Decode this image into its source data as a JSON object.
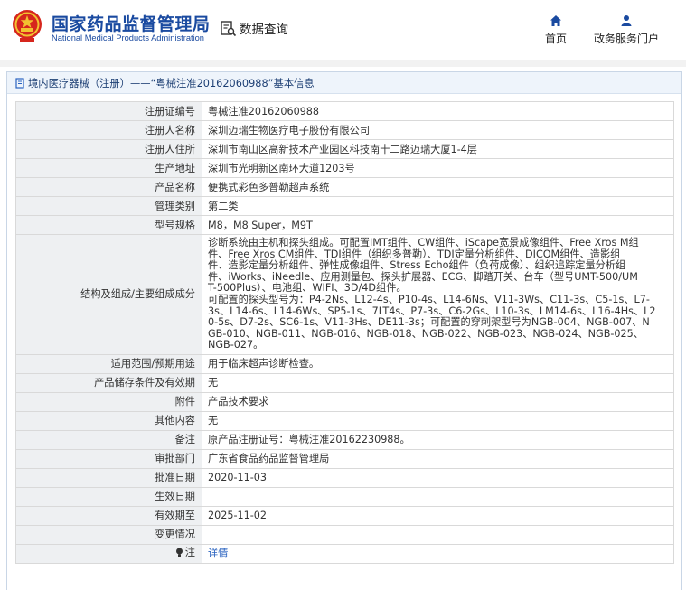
{
  "header": {
    "site_name_cn": "国家药品监督管理局",
    "site_name_en": "National Medical Products Administration",
    "data_query_label": "数据查询",
    "nav": [
      {
        "label": "首页",
        "icon": "home-icon"
      },
      {
        "label": "政务服务门户",
        "icon": "user-icon"
      }
    ]
  },
  "breadcrumb": {
    "text": "境内医疗器械（注册）——“粤械注准20162060988”基本信息"
  },
  "record": {
    "rows": [
      {
        "label": "注册证编号",
        "value": "粤械注准20162060988"
      },
      {
        "label": "注册人名称",
        "value": "深圳迈瑞生物医疗电子股份有限公司"
      },
      {
        "label": "注册人住所",
        "value": "深圳市南山区高新技术产业园区科技南十二路迈瑞大厦1-4层"
      },
      {
        "label": "生产地址",
        "value": "深圳市光明新区南环大道1203号"
      },
      {
        "label": "产品名称",
        "value": "便携式彩色多普勒超声系统"
      },
      {
        "label": "管理类别",
        "value": "第二类"
      },
      {
        "label": "型号规格",
        "value": "M8，M8 Super，M9T"
      },
      {
        "label": "结构及组成/主要组成成分",
        "value_lines": [
          "诊断系统由主机和探头组成。可配置IMT组件、CW组件、iScape宽景成像组件、Free Xros M组",
          "件、Free Xros CM组件、TDI组件（组织多普勒）、TDI定量分析组件、DICOM组件、造影组",
          "件、造影定量分析组件、弹性成像组件、Stress Echo组件（负荷成像）、组织追踪定量分析组",
          "件、iWorks、iNeedle、应用测量包、探头扩展器、ECG、脚踏开关、台车（型号UMT-500/UM",
          "T-500Plus）、电池组、WIFI、3D/4D组件。",
          "可配置的探头型号为：P4-2Ns、L12-4s、P10-4s、L14-6Ns、V11-3Ws、C11-3s、C5-1s、L7-",
          "3s、L14-6s、L14-6Ws、SP5-1s、7LT4s、P7-3s、C6-2Gs、L10-3s、LM14-6s、L16-4Hs、L2",
          "0-5s、D7-2s、SC6-1s、V11-3Hs、DE11-3s；可配置的穿刺架型号为NGB-004、NGB-007、N",
          "GB-010、NGB-011、NGB-016、NGB-018、NGB-022、NGB-023、NGB-024、NGB-025、",
          "NGB-027。"
        ]
      },
      {
        "label": "适用范围/预期用途",
        "value": "用于临床超声诊断检查。"
      },
      {
        "label": "产品储存条件及有效期",
        "value": "无"
      },
      {
        "label": "附件",
        "value": "产品技术要求"
      },
      {
        "label": "其他内容",
        "value": "无"
      },
      {
        "label": "备注",
        "value": "原产品注册证号：粤械注准20162230988。"
      },
      {
        "label": "审批部门",
        "value": "广东省食品药品监督管理局"
      },
      {
        "label": "批准日期",
        "value": "2020-11-03"
      },
      {
        "label": "生效日期",
        "value": ""
      },
      {
        "label": "有效期至",
        "value": "2025-11-02"
      },
      {
        "label": "变更情况",
        "value": ""
      },
      {
        "label": "注",
        "value": "详情"
      }
    ]
  },
  "colors": {
    "brand_blue": "#1a4aa0",
    "emblem_red": "#d6261d",
    "emblem_gold": "#f2c230",
    "label_bg": "#eef0f2",
    "link_blue": "#2a63c0"
  }
}
